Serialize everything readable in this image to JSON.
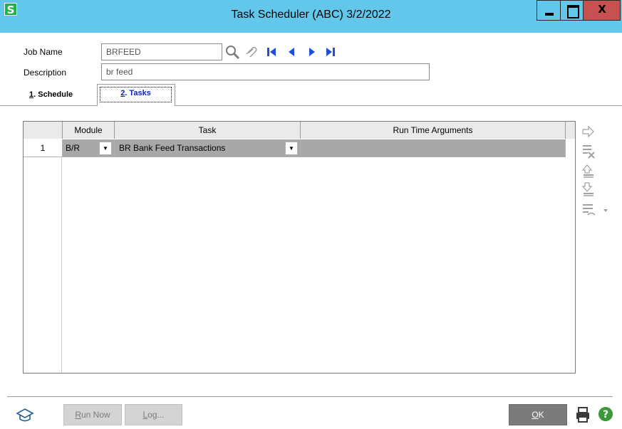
{
  "window": {
    "app_icon": "S",
    "title": "Task Scheduler (ABC) 3/2/2022",
    "close_label": "X"
  },
  "header": {
    "job_name_label": "Job Name",
    "job_name_value": "BRFEED",
    "description_label": "Description",
    "description_value": "br feed"
  },
  "tabs": [
    {
      "hotkey": "1",
      "label": ". Schedule",
      "selected": false
    },
    {
      "hotkey": "2",
      "label": ". Tasks",
      "selected": true
    }
  ],
  "grid": {
    "columns": [
      "Module",
      "Task",
      "Run Time Arguments"
    ],
    "rows": [
      {
        "num": "1",
        "module": "B/R",
        "task": "BR Bank Feed Transactions",
        "args": ""
      }
    ]
  },
  "footer": {
    "run_now_hotkey": "R",
    "run_now_rest": "un Now",
    "log_hotkey": "L",
    "log_rest": "og...",
    "ok_hotkey": "O",
    "ok_rest": "K"
  },
  "icons": [
    "app-s-icon",
    "lookup-icon",
    "link-icon",
    "first-record-icon",
    "previous-record-icon",
    "next-record-icon",
    "last-record-icon",
    "insert-row-icon",
    "delete-row-icon",
    "move-up-icon",
    "move-down-icon",
    "options-icon",
    "setup-cap-icon",
    "printer-icon",
    "help-icon"
  ],
  "colors": {
    "titlebar": "#63c7ec",
    "close": "#c75050",
    "selected_row": "#a8a8a8",
    "nav_arrows": "#1f4fd8",
    "tab_text": "#0b1fc8"
  }
}
